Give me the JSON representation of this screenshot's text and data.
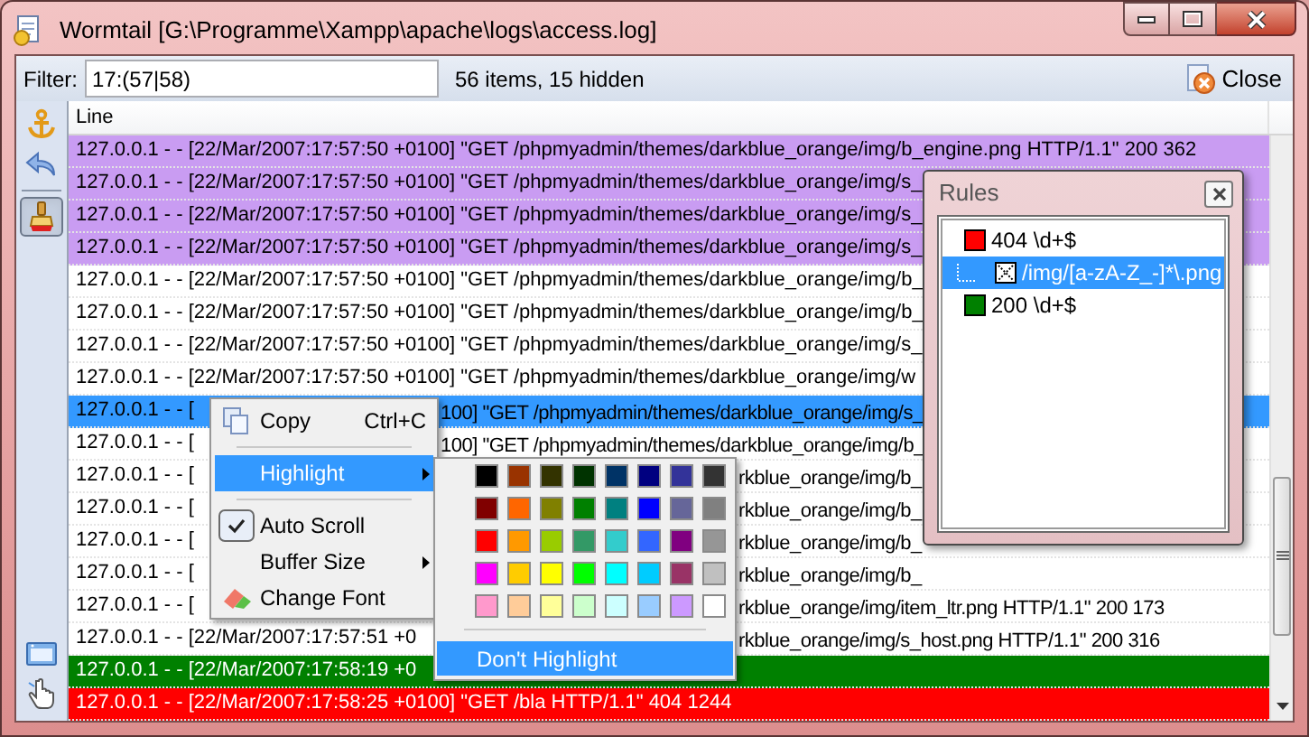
{
  "window": {
    "title": "Wormtail [G:\\Programme\\Xampp\\apache\\logs\\access.log]"
  },
  "toolbar": {
    "filter_label": "Filter:",
    "filter_value": "17:(57|58)",
    "status": "56 items, 15 hidden",
    "close_button": "Close"
  },
  "side_tools": [
    {
      "selected": false
    },
    {
      "selected": false
    },
    {
      "selected": true
    },
    {
      "selected": false
    },
    {
      "selected": false
    }
  ],
  "log": {
    "column": "Line",
    "rows": [
      {
        "text": "127.0.0.1 - - [22/Mar/2007:17:57:50 +0100] \"GET /phpmyadmin/themes/darkblue_orange/img/b_engine.png HTTP/1.1\" 200 362",
        "color": "#c99cf2",
        "selected": false
      },
      {
        "text": "127.0.0.1 - - [22/Mar/2007:17:57:50 +0100] \"GET /phpmyadmin/themes/darkblue_orange/img/s_",
        "color": "#c99cf2",
        "selected": false
      },
      {
        "text": "127.0.0.1 - - [22/Mar/2007:17:57:50 +0100] \"GET /phpmyadmin/themes/darkblue_orange/img/s_",
        "color": "#c99cf2",
        "selected": false
      },
      {
        "text": "127.0.0.1 - - [22/Mar/2007:17:57:50 +0100] \"GET /phpmyadmin/themes/darkblue_orange/img/s_",
        "color": "#c99cf2",
        "selected": false
      },
      {
        "text": "127.0.0.1 - - [22/Mar/2007:17:57:50 +0100] \"GET /phpmyadmin/themes/darkblue_orange/img/b_",
        "selected": false
      },
      {
        "text": "127.0.0.1 - - [22/Mar/2007:17:57:50 +0100] \"GET /phpmyadmin/themes/darkblue_orange/img/b_",
        "selected": false
      },
      {
        "text": "127.0.0.1 - - [22/Mar/2007:17:57:50 +0100] \"GET /phpmyadmin/themes/darkblue_orange/img/s_",
        "selected": false
      },
      {
        "text": "127.0.0.1 - - [22/Mar/2007:17:57:50 +0100] \"GET /phpmyadmin/themes/darkblue_orange/img/w",
        "selected": false
      },
      {
        "text": "127.0.0.1 - - [",
        "tail": "100] \"GET /phpmyadmin/themes/darkblue_orange/img/s_",
        "selected": true
      },
      {
        "text": "127.0.0.1 - - [",
        "tail": "100] \"GET /phpmyadmin/themes/darkblue_orange/img/b_",
        "selected": false
      },
      {
        "text": "127.0.0.1 - - [",
        "tail": "rkblue_orange/img/b_",
        "selected": false
      },
      {
        "text": "127.0.0.1 - - [",
        "tail": "rkblue_orange/img/b_",
        "selected": false
      },
      {
        "text": "127.0.0.1 - - [",
        "tail": "rkblue_orange/img/b_",
        "selected": false
      },
      {
        "text": "127.0.0.1 - - [",
        "tail": "rkblue_orange/img/b_",
        "selected": false
      },
      {
        "text": "127.0.0.1 - - [",
        "tail": "rkblue_orange/img/item_ltr.png HTTP/1.1\" 200 173",
        "selected": false
      },
      {
        "text": "127.0.0.1 - - [22/Mar/2007:17:57:51 +0",
        "tail": "rkblue_orange/img/s_host.png HTTP/1.1\" 200 316",
        "selected": false
      },
      {
        "text": "127.0.0.1 - - [22/Mar/2007:17:58:19 +0",
        "color": "#008000",
        "selected": false
      },
      {
        "text": "127.0.0.1 - - [22/Mar/2007:17:58:25 +0100] \"GET /bla HTTP/1.1\" 404 1244",
        "color": "#ff0000",
        "selected": false
      }
    ]
  },
  "context_menu": {
    "items": [
      {
        "kind": "item",
        "label": "Copy",
        "shortcut": "Ctrl+C",
        "checked": false,
        "submenu": false,
        "selected": false
      },
      {
        "kind": "separator"
      },
      {
        "kind": "item",
        "label": "Highlight",
        "checked": false,
        "submenu": true,
        "selected": true
      },
      {
        "kind": "separator"
      },
      {
        "kind": "item",
        "label": "Auto Scroll",
        "checked": true,
        "submenu": false,
        "selected": false
      },
      {
        "kind": "item",
        "label": "Buffer Size",
        "checked": false,
        "submenu": true,
        "selected": false
      },
      {
        "kind": "item",
        "label": "Change Font",
        "checked": false,
        "submenu": false,
        "selected": false
      }
    ]
  },
  "highlight_submenu": {
    "swatches": [
      {
        "color": "#000000"
      },
      {
        "color": "#993300"
      },
      {
        "color": "#333300"
      },
      {
        "color": "#003300"
      },
      {
        "color": "#003366"
      },
      {
        "color": "#000080"
      },
      {
        "color": "#333399"
      },
      {
        "color": "#333333"
      },
      {
        "color": "#800000"
      },
      {
        "color": "#ff6600"
      },
      {
        "color": "#808000"
      },
      {
        "color": "#008000"
      },
      {
        "color": "#008080"
      },
      {
        "color": "#0000ff"
      },
      {
        "color": "#666699"
      },
      {
        "color": "#808080"
      },
      {
        "color": "#ff0000"
      },
      {
        "color": "#ff9900"
      },
      {
        "color": "#99cc00"
      },
      {
        "color": "#339966"
      },
      {
        "color": "#33cccc"
      },
      {
        "color": "#3366ff"
      },
      {
        "color": "#800080"
      },
      {
        "color": "#969696"
      },
      {
        "color": "#ff00ff"
      },
      {
        "color": "#ffcc00"
      },
      {
        "color": "#ffff00"
      },
      {
        "color": "#00ff00"
      },
      {
        "color": "#00ffff"
      },
      {
        "color": "#00ccff"
      },
      {
        "color": "#993366"
      },
      {
        "color": "#c0c0c0"
      },
      {
        "color": "#ff99cc"
      },
      {
        "color": "#ffcc99"
      },
      {
        "color": "#ffff99"
      },
      {
        "color": "#ccffcc"
      },
      {
        "color": "#ccffff"
      },
      {
        "color": "#99ccff"
      },
      {
        "color": "#cc99ff"
      },
      {
        "color": "#ffffff"
      }
    ],
    "dont_highlight": {
      "label": "Don't Highlight",
      "selected": true
    }
  },
  "rules_panel": {
    "title": "Rules",
    "rules": [
      {
        "label": "404 \\d+$",
        "color": "#ff0000",
        "selected": false,
        "children": [
          {
            "label": "/img/[a-zA-Z_-]*\\.png",
            "selected": true
          }
        ]
      },
      {
        "label": "200 \\d+$",
        "color": "#008000",
        "selected": false
      }
    ]
  }
}
